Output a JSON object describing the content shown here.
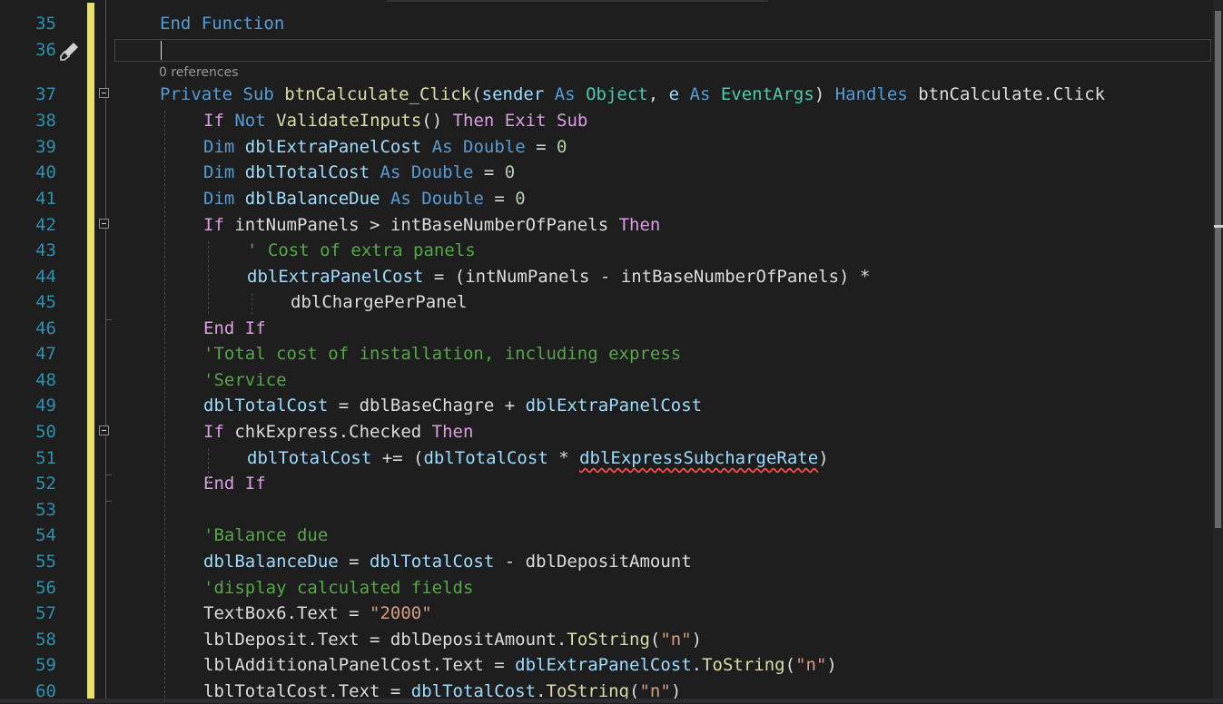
{
  "editor": {
    "codelens": "0 references",
    "lines": [
      {
        "n": "35",
        "tokens": [
          [
            "kw",
            "End Function"
          ]
        ]
      },
      {
        "n": "36",
        "tokens": []
      },
      {
        "n": "37",
        "tokens": [
          [
            "kw",
            "Private Sub "
          ],
          [
            "fn",
            "btnCalculate_Click"
          ],
          [
            "p",
            "("
          ],
          [
            "var",
            "sender"
          ],
          [
            "p",
            " "
          ],
          [
            "kw",
            "As"
          ],
          [
            "p",
            " "
          ],
          [
            "ty",
            "Object"
          ],
          [
            "p",
            ", "
          ],
          [
            "var",
            "e"
          ],
          [
            "p",
            " "
          ],
          [
            "kw",
            "As"
          ],
          [
            "p",
            " "
          ],
          [
            "ty",
            "EventArgs"
          ],
          [
            "p",
            ") "
          ],
          [
            "kw",
            "Handles"
          ],
          [
            "p",
            " btnCalculate.Click"
          ]
        ]
      },
      {
        "n": "38",
        "tokens": [
          [
            "ctl",
            "If"
          ],
          [
            "p",
            " "
          ],
          [
            "kw",
            "Not"
          ],
          [
            "p",
            " "
          ],
          [
            "fn",
            "ValidateInputs"
          ],
          [
            "p",
            "() "
          ],
          [
            "ctl",
            "Then Exit Sub"
          ]
        ]
      },
      {
        "n": "39",
        "tokens": [
          [
            "kw",
            "Dim "
          ],
          [
            "var",
            "dblExtraPanelCost"
          ],
          [
            "p",
            " "
          ],
          [
            "kw",
            "As Double"
          ],
          [
            "p",
            " = "
          ],
          [
            "num",
            "0"
          ]
        ]
      },
      {
        "n": "40",
        "tokens": [
          [
            "kw",
            "Dim "
          ],
          [
            "var",
            "dblTotalCost"
          ],
          [
            "p",
            " "
          ],
          [
            "kw",
            "As Double"
          ],
          [
            "p",
            " = "
          ],
          [
            "num",
            "0"
          ]
        ]
      },
      {
        "n": "41",
        "tokens": [
          [
            "kw",
            "Dim "
          ],
          [
            "var",
            "dblBalanceDue"
          ],
          [
            "p",
            " "
          ],
          [
            "kw",
            "As Double"
          ],
          [
            "p",
            " = "
          ],
          [
            "num",
            "0"
          ]
        ]
      },
      {
        "n": "42",
        "tokens": [
          [
            "ctl",
            "If"
          ],
          [
            "p",
            " intNumPanels > intBaseNumberOfPanels "
          ],
          [
            "ctl",
            "Then"
          ]
        ]
      },
      {
        "n": "43",
        "tokens": [
          [
            "com",
            "' Cost of extra panels"
          ]
        ]
      },
      {
        "n": "44",
        "tokens": [
          [
            "var",
            "dblExtraPanelCost"
          ],
          [
            "p",
            " = (intNumPanels - intBaseNumberOfPanels) *"
          ]
        ]
      },
      {
        "n": "45",
        "tokens": [
          [
            "p",
            "dblChargePerPanel"
          ]
        ]
      },
      {
        "n": "46",
        "tokens": [
          [
            "ctl",
            "End If"
          ]
        ]
      },
      {
        "n": "47",
        "tokens": [
          [
            "com",
            "'Total cost of installation, including express"
          ]
        ]
      },
      {
        "n": "48",
        "tokens": [
          [
            "com",
            "'Service"
          ]
        ]
      },
      {
        "n": "49",
        "tokens": [
          [
            "var",
            "dblTotalCost"
          ],
          [
            "p",
            " = dblBaseChagre + "
          ],
          [
            "var",
            "dblExtraPanelCost"
          ]
        ]
      },
      {
        "n": "50",
        "tokens": [
          [
            "ctl",
            "If"
          ],
          [
            "p",
            " chkExpress.Checked "
          ],
          [
            "ctl",
            "Then"
          ]
        ]
      },
      {
        "n": "51",
        "tokens": [
          [
            "var",
            "dblTotalCost"
          ],
          [
            "p",
            " += ("
          ],
          [
            "var",
            "dblTotalCost"
          ],
          [
            "p",
            " * "
          ],
          [
            "err",
            "dblExpressSubchargeRate"
          ],
          [
            "p",
            ")"
          ]
        ]
      },
      {
        "n": "52",
        "tokens": [
          [
            "ctl",
            "End If"
          ]
        ]
      },
      {
        "n": "53",
        "tokens": []
      },
      {
        "n": "54",
        "tokens": [
          [
            "com",
            "'Balance due"
          ]
        ]
      },
      {
        "n": "55",
        "tokens": [
          [
            "var",
            "dblBalanceDue"
          ],
          [
            "p",
            " = "
          ],
          [
            "var",
            "dblTotalCost"
          ],
          [
            "p",
            " - dblDepositAmount"
          ]
        ]
      },
      {
        "n": "56",
        "tokens": [
          [
            "com",
            "'display calculated fields"
          ]
        ]
      },
      {
        "n": "57",
        "tokens": [
          [
            "p",
            "TextBox6.Text = "
          ],
          [
            "str",
            "\"2000\""
          ]
        ]
      },
      {
        "n": "58",
        "tokens": [
          [
            "p",
            "lblDeposit.Text = dblDepositAmount."
          ],
          [
            "fn",
            "ToString"
          ],
          [
            "p",
            "("
          ],
          [
            "str",
            "\"n\""
          ],
          [
            "p",
            ")"
          ]
        ]
      },
      {
        "n": "59",
        "tokens": [
          [
            "p",
            "lblAdditionalPanelCost.Text = "
          ],
          [
            "var",
            "dblExtraPanelCost"
          ],
          [
            "p",
            "."
          ],
          [
            "fn",
            "ToString"
          ],
          [
            "p",
            "("
          ],
          [
            "str",
            "\"n\""
          ],
          [
            "p",
            ")"
          ]
        ]
      },
      {
        "n": "60",
        "tokens": [
          [
            "p",
            "lblTotalCost.Text = "
          ],
          [
            "var",
            "dblTotalCost"
          ],
          [
            "p",
            "."
          ],
          [
            "fn",
            "ToString"
          ],
          [
            "p",
            "("
          ],
          [
            "str",
            "\"n\""
          ],
          [
            "p",
            ")"
          ]
        ]
      }
    ]
  },
  "colors": {
    "background": "#1e1e1e",
    "line_number": "#2b91af",
    "keyword": "#569cd6",
    "control": "#d8a0df",
    "method": "#dcdcaa",
    "type": "#4ec9b0",
    "variable": "#9cdcfe",
    "number": "#b5cea8",
    "string": "#d69d85",
    "comment": "#57a64a",
    "change_bar": "#e6e16a"
  }
}
